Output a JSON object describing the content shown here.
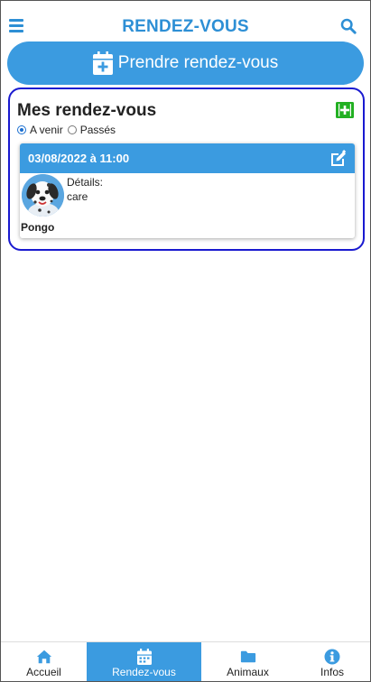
{
  "header": {
    "title": "RENDEZ-VOUS",
    "menu_icon": "hamburger-icon",
    "search_icon": "search-icon"
  },
  "take_appointment": {
    "label": "Prendre rendez-vous",
    "icon": "calendar-plus-icon"
  },
  "panel": {
    "title": "Mes rendez-vous",
    "add_icon": "add-square-icon",
    "filters": [
      {
        "label": "A venir",
        "selected": true
      },
      {
        "label": "Passés",
        "selected": false
      }
    ]
  },
  "appointments": [
    {
      "datetime": "03/08/2022 à 11:00",
      "details_label": "Détails:",
      "details": "care",
      "pet_name": "Pongo",
      "edit_icon": "edit-icon",
      "avatar": "dalmatian-avatar"
    }
  ],
  "nav": {
    "items": [
      {
        "label": "Accueil",
        "icon": "home-icon",
        "active": false
      },
      {
        "label": "Rendez-vous",
        "icon": "calendar-icon",
        "active": true
      },
      {
        "label": "Animaux",
        "icon": "folder-icon",
        "active": false
      },
      {
        "label": "Infos",
        "icon": "info-icon",
        "active": false
      }
    ]
  },
  "colors": {
    "primary": "#3b9be0",
    "title": "#2d8fd5",
    "panel_border": "#1a1ad0",
    "add_icon": "#22b022"
  }
}
